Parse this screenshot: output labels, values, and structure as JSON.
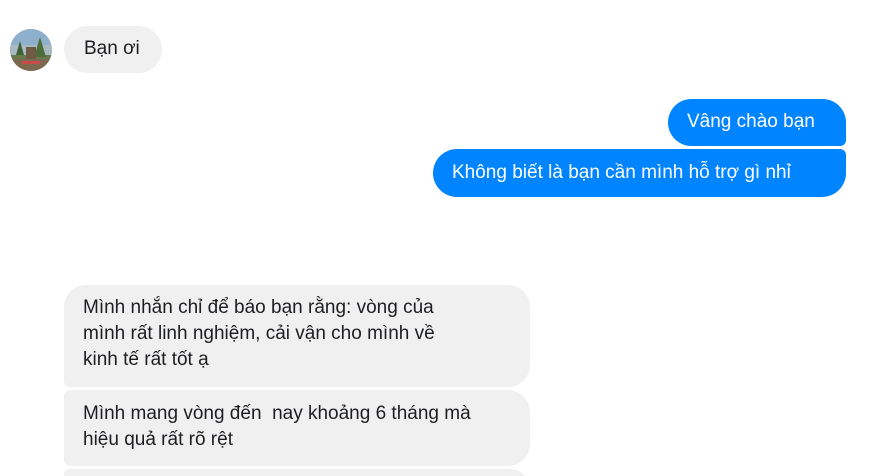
{
  "conversation": {
    "messages": [
      {
        "direction": "incoming",
        "lines": [
          "Bạn ơi"
        ]
      },
      {
        "direction": "outgoing",
        "lines": [
          "Vâng chào bạn"
        ]
      },
      {
        "direction": "outgoing",
        "lines": [
          "Không biết là bạn cần mình hỗ trợ gì nhỉ"
        ]
      },
      {
        "direction": "incoming",
        "lines": [
          "Mình nhắn chỉ để báo bạn rằng: vòng của",
          "mình rất linh nghiệm, cải vận cho mình về",
          "kinh tế rất tốt ạ"
        ]
      },
      {
        "direction": "incoming",
        "lines": [
          "Mình mang vòng đến  nay khoảng 6 tháng mà",
          "hiệu quả rất rõ rệt"
        ]
      },
      {
        "direction": "incoming",
        "lines": []
      }
    ]
  },
  "colors": {
    "incoming_bubble": "#f1f0f0",
    "outgoing_bubble": "#0084ff",
    "incoming_text": "#1c1e21",
    "outgoing_text": "#ffffff"
  },
  "icons": {
    "sender_avatar": "avatar-photo"
  }
}
